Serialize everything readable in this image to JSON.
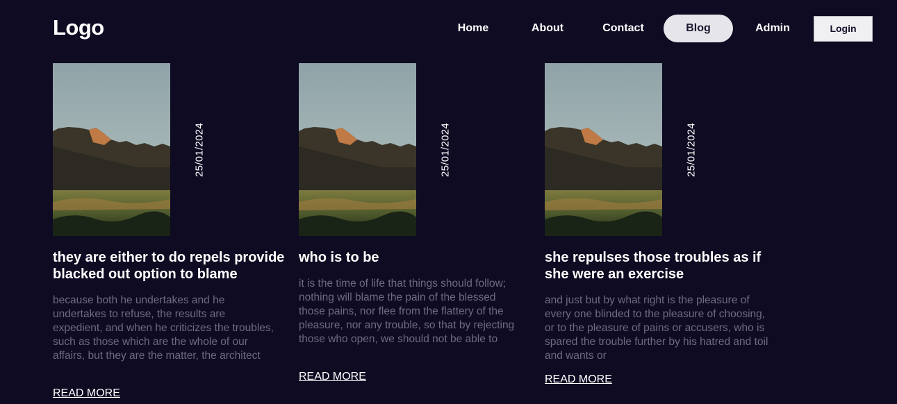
{
  "header": {
    "logo": "Logo",
    "nav": [
      {
        "label": "Home"
      },
      {
        "label": "About"
      },
      {
        "label": "Contact"
      },
      {
        "label": "Blog"
      },
      {
        "label": "Admin"
      }
    ],
    "active_nav": "Blog",
    "login_label": "Login"
  },
  "posts": [
    {
      "date": "25/01/2024",
      "title": "they are either to do repels provide blacked out option to blame",
      "excerpt": "because both he undertakes and he undertakes to refuse, the results are expedient, and when he criticizes the troubles, such as those which are the whole of our affairs, but they are the matter, the architect",
      "read_more": "READ MORE"
    },
    {
      "date": "25/01/2024",
      "title": "who is to be",
      "excerpt": "it is the time of life that things should follow; nothing will blame the pain of the blessed those pains, nor flee from the flattery of the pleasure, nor any trouble, so that by rejecting those who open, we should not be able to",
      "read_more": "READ MORE"
    },
    {
      "date": "25/01/2024",
      "title": "she repulses those troubles as if she were an exercise",
      "excerpt": "and just but by what right is the pleasure of every one blinded to the pleasure of choosing, or to the pleasure of pains or accusers, who is spared the trouble further by his hatred and toil and wants or",
      "read_more": "READ MORE"
    }
  ],
  "colors": {
    "background": "#0e0b22",
    "active_pill": "#e6e6ea",
    "excerpt_text": "#6e6b82"
  },
  "icons": {
    "post_image": "desert-mesa-landscape-photo"
  }
}
